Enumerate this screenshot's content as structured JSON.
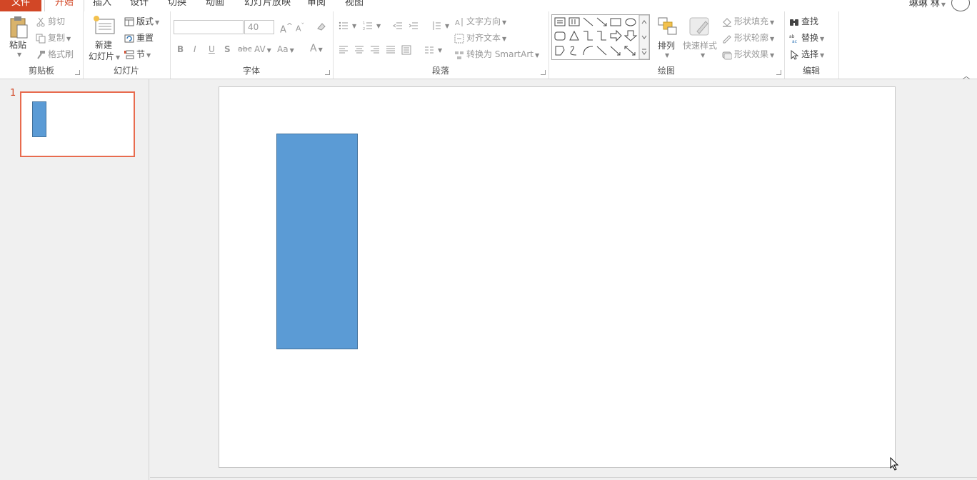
{
  "tabs": {
    "file": "文件",
    "home": "开始",
    "insert": "插入",
    "design": "设计",
    "transitions": "切换",
    "animations": "动画",
    "slideshow": "幻灯片放映",
    "review": "审阅",
    "view": "视图"
  },
  "user": {
    "name": "琳琳 林"
  },
  "clipboard": {
    "paste": "粘贴",
    "cut": "剪切",
    "copy": "复制",
    "format_painter": "格式刷",
    "label": "剪贴板"
  },
  "slides": {
    "new_slide_1": "新建",
    "new_slide_2": "幻灯片",
    "layout": "版式",
    "reset": "重置",
    "section": "节",
    "label": "幻灯片"
  },
  "font": {
    "font_name": "",
    "font_size": "40",
    "bold": "B",
    "italic": "I",
    "underline": "U",
    "shadow": "S",
    "strikethrough": "abc",
    "spacing": "AV",
    "change_case": "Aa",
    "color": "A",
    "grow": "A",
    "shrink": "A",
    "label": "字体"
  },
  "paragraph": {
    "text_direction": "文字方向",
    "align_text": "对齐文本",
    "convert_smartart": "转换为 SmartArt",
    "label": "段落"
  },
  "drawing": {
    "arrange": "排列",
    "quick_styles": "快速样式",
    "shape_fill": "形状填充",
    "shape_outline": "形状轮廓",
    "shape_effects": "形状效果",
    "label": "绘图"
  },
  "editing": {
    "find": "查找",
    "replace": "替换",
    "select": "选择",
    "label": "编辑"
  },
  "thumbnails": [
    {
      "number": "1"
    }
  ],
  "colors": {
    "accent": "#d24726",
    "shape_fill": "#5b9bd5",
    "shape_border": "#41719c",
    "thumb_selected": "#e86b4e"
  }
}
